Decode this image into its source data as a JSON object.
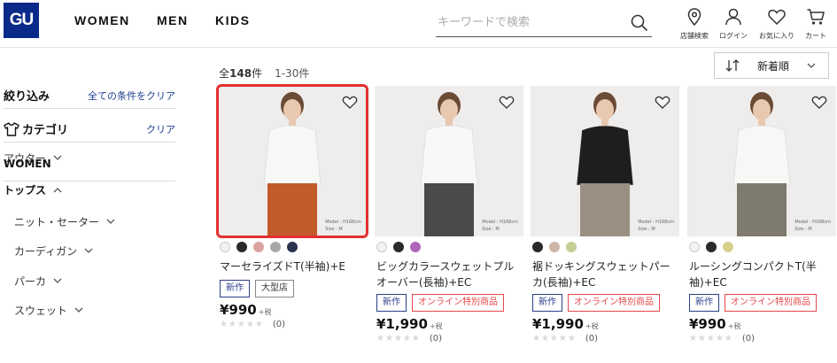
{
  "header": {
    "logo": "GU",
    "nav": [
      "WOMEN",
      "MEN",
      "KIDS"
    ],
    "search_placeholder": "キーワードで検索",
    "icons": [
      {
        "name": "store-icon",
        "label": "店舗検索"
      },
      {
        "name": "user-icon",
        "label": "ログイン"
      },
      {
        "name": "heart-icon",
        "label": "お気に入り"
      },
      {
        "name": "cart-icon",
        "label": "カート"
      }
    ]
  },
  "sidebar": {
    "filter_title": "絞り込み",
    "clear_all": "全ての条件をクリア",
    "category_title": "カテゴリ",
    "category_clear": "クリア",
    "section": "WOMEN",
    "items": [
      {
        "label": "アウター",
        "expanded": false,
        "bold": false,
        "indent": false
      },
      {
        "label": "トップス",
        "expanded": true,
        "bold": true,
        "indent": false
      },
      {
        "label": "ニット・セーター",
        "expanded": false,
        "bold": false,
        "indent": true
      },
      {
        "label": "カーディガン",
        "expanded": false,
        "bold": false,
        "indent": true
      },
      {
        "label": "パーカ",
        "expanded": false,
        "bold": false,
        "indent": true
      },
      {
        "label": "スウェット",
        "expanded": false,
        "bold": false,
        "indent": true
      }
    ]
  },
  "results": {
    "prefix": "全",
    "total": "148",
    "unit": "件",
    "range": "1-30件"
  },
  "sort": {
    "label": "新着順"
  },
  "products": [
    {
      "name": "マーセライズドT(半袖)+E",
      "selected": true,
      "colors": [
        "#f2f2f2",
        "#2a2a2a",
        "#d9a3a0",
        "#a7a7a7",
        "#2a3350"
      ],
      "badges": [
        {
          "text": "新作",
          "type": "new"
        },
        {
          "text": "大型店",
          "type": "store"
        }
      ],
      "price": "¥990",
      "tax": "+税",
      "reviews": "(0)",
      "model_caption": [
        "Model : H168cm",
        "Size : M"
      ],
      "top_color": "#f7f7f5",
      "bottom_color": "#c25a2a"
    },
    {
      "name": "ビッグカラースウェットプルオーバー(長袖)+EC",
      "selected": false,
      "colors": [
        "#f2f2f2",
        "#2a2a2a",
        "#b066b8"
      ],
      "badges": [
        {
          "text": "新作",
          "type": "new"
        },
        {
          "text": "オンライン特別商品",
          "type": "online"
        }
      ],
      "price": "¥1,990",
      "tax": "+税",
      "reviews": "(0)",
      "model_caption": [
        "Model : H168cm",
        "Size : M"
      ],
      "top_color": "#f8f8f8",
      "bottom_color": "#4a4a4a"
    },
    {
      "name": "裾ドッキングスウェットパーカ(長袖)+EC",
      "selected": false,
      "colors": [
        "#2a2a2a",
        "#cdb5a8",
        "#c6cc96"
      ],
      "badges": [
        {
          "text": "新作",
          "type": "new"
        },
        {
          "text": "オンライン特別商品",
          "type": "online"
        }
      ],
      "price": "¥1,990",
      "tax": "+税",
      "reviews": "(0)",
      "model_caption": [
        "Model : H168cm",
        "Size : M"
      ],
      "top_color": "#1e1e1e",
      "bottom_color": "#9a8f82"
    },
    {
      "name": "ルーシングコンパクトT(半袖)+EC",
      "selected": false,
      "colors": [
        "#f2f2f2",
        "#2a2a2a",
        "#d9cf8c"
      ],
      "badges": [
        {
          "text": "新作",
          "type": "new"
        },
        {
          "text": "オンライン特別商品",
          "type": "online"
        }
      ],
      "price": "¥990",
      "tax": "+税",
      "reviews": "(0)",
      "model_caption": [
        "Model : H168cm",
        "Size : M"
      ],
      "top_color": "#f7f7f5",
      "bottom_color": "#7f7a6e"
    }
  ]
}
